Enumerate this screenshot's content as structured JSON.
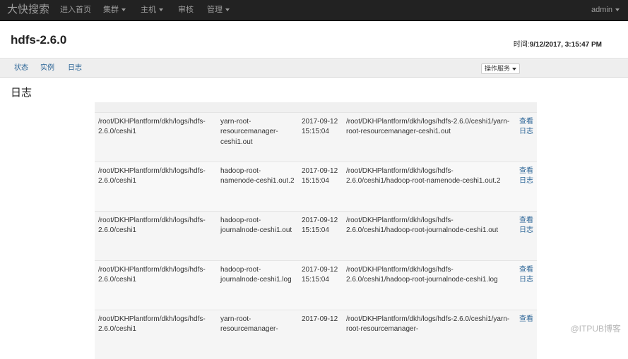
{
  "navbar": {
    "brand": "大快搜索",
    "items": [
      {
        "label": "进入首页",
        "dropdown": false
      },
      {
        "label": "集群",
        "dropdown": true
      },
      {
        "label": "主机",
        "dropdown": true
      },
      {
        "label": "审核",
        "dropdown": false
      },
      {
        "label": "管理",
        "dropdown": true
      }
    ],
    "user": "admin"
  },
  "header": {
    "title": "hdfs-2.6.0",
    "time_label": "时间:",
    "time_value": "9/12/2017, 3:15:47 PM"
  },
  "subnav": {
    "tabs": [
      "状态",
      "实例",
      "日志"
    ],
    "ops_button": "操作服务"
  },
  "section_title": "日志",
  "logs": [
    {
      "dir": "/root/DKHPlantform/dkh/logs/hdfs-2.6.0/ceshi1",
      "file": "yarn-root-resourcemanager-ceshi1.out",
      "date": "2017-09-12 15:15:04",
      "path": "/root/DKHPlantform/dkh/logs/hdfs-2.6.0/ceshi1/yarn-root-resourcemanager-ceshi1.out",
      "action": "查看日志"
    },
    {
      "dir": "/root/DKHPlantform/dkh/logs/hdfs-2.6.0/ceshi1",
      "file": "hadoop-root-namenode-ceshi1.out.2",
      "date": "2017-09-12 15:15:04",
      "path": "/root/DKHPlantform/dkh/logs/hdfs-2.6.0/ceshi1/hadoop-root-namenode-ceshi1.out.2",
      "action": "查看日志"
    },
    {
      "dir": "/root/DKHPlantform/dkh/logs/hdfs-2.6.0/ceshi1",
      "file": "hadoop-root-journalnode-ceshi1.out",
      "date": "2017-09-12 15:15:04",
      "path": "/root/DKHPlantform/dkh/logs/hdfs-2.6.0/ceshi1/hadoop-root-journalnode-ceshi1.out",
      "action": "查看日志"
    },
    {
      "dir": "/root/DKHPlantform/dkh/logs/hdfs-2.6.0/ceshi1",
      "file": "hadoop-root-journalnode-ceshi1.log",
      "date": "2017-09-12 15:15:04",
      "path": "/root/DKHPlantform/dkh/logs/hdfs-2.6.0/ceshi1/hadoop-root-journalnode-ceshi1.log",
      "action": "查看日志"
    },
    {
      "dir": "/root/DKHPlantform/dkh/logs/hdfs-2.6.0/ceshi1",
      "file": "yarn-root-resourcemanager-",
      "date": "2017-09-12",
      "path": "/root/DKHPlantform/dkh/logs/hdfs-2.6.0/ceshi1/yarn-root-resourcemanager-",
      "action": "查看"
    }
  ],
  "watermark": "@ITPUB博客"
}
